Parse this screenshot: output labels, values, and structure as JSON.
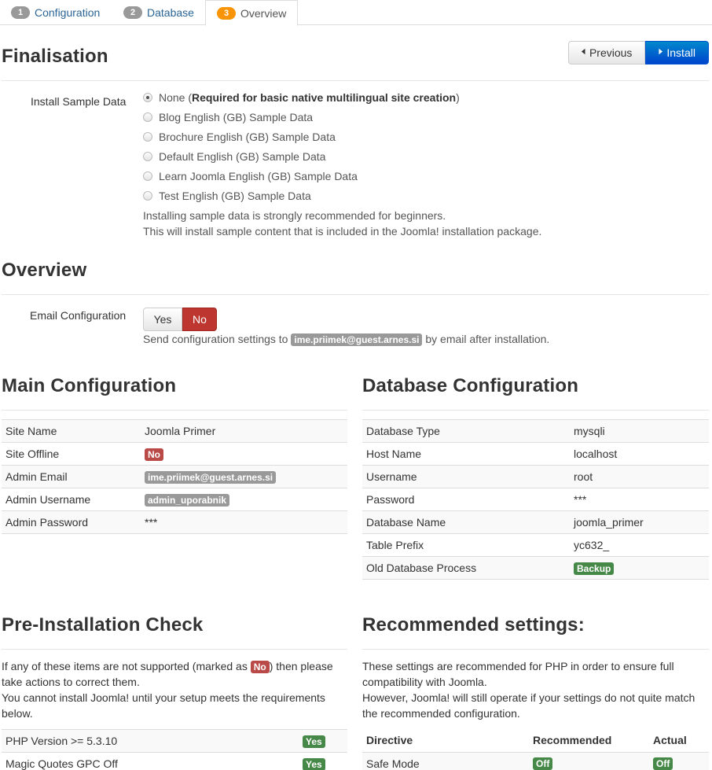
{
  "tabs": [
    {
      "num": "1",
      "label": "Configuration"
    },
    {
      "num": "2",
      "label": "Database"
    },
    {
      "num": "3",
      "label": "Overview"
    }
  ],
  "finalisation": {
    "title": "Finalisation",
    "previous_label": "Previous",
    "install_label": "Install",
    "sample_label": "Install Sample Data",
    "options": [
      {
        "label": "None (",
        "strong": "Required for basic native multilingual site creation",
        "tail": ")",
        "checked": true
      },
      {
        "label": "Blog English (GB) Sample Data",
        "checked": false
      },
      {
        "label": "Brochure English (GB) Sample Data",
        "checked": false
      },
      {
        "label": "Default English (GB) Sample Data",
        "checked": false
      },
      {
        "label": "Learn Joomla English (GB) Sample Data",
        "checked": false
      },
      {
        "label": "Test English (GB) Sample Data",
        "checked": false
      }
    ],
    "help1": "Installing sample data is strongly recommended for beginners.",
    "help2": "This will install sample content that is included in the Joomla! installation package."
  },
  "overview": {
    "title": "Overview",
    "email_label": "Email Configuration",
    "yes": "Yes",
    "no": "No",
    "send_prefix": "Send configuration settings to",
    "email": "ime.priimek@guest.arnes.si",
    "send_suffix": "by email after installation."
  },
  "main_config": {
    "title": "Main Configuration",
    "rows": [
      {
        "label": "Site Name",
        "value": "Joomla Primer"
      },
      {
        "label": "Site Offline",
        "value": "No"
      },
      {
        "label": "Admin Email",
        "value": "ime.priimek@guest.arnes.si"
      },
      {
        "label": "Admin Username",
        "value": "admin_uporabnik"
      },
      {
        "label": "Admin Password",
        "value": "***"
      }
    ]
  },
  "db_config": {
    "title": "Database Configuration",
    "rows": [
      {
        "label": "Database Type",
        "value": "mysqli"
      },
      {
        "label": "Host Name",
        "value": "localhost"
      },
      {
        "label": "Username",
        "value": "root"
      },
      {
        "label": "Password",
        "value": "***"
      },
      {
        "label": "Database Name",
        "value": "joomla_primer"
      },
      {
        "label": "Table Prefix",
        "value": "yc632_"
      },
      {
        "label": "Old Database Process",
        "value": "Backup"
      }
    ]
  },
  "preinstall": {
    "title": "Pre-Installation Check",
    "p1a": "If any of these items are not supported (marked as",
    "p1_badge": "No",
    "p1b": ") then please",
    "p2": "take actions to correct them.",
    "p3": "You cannot install Joomla! until your setup meets the requirements",
    "p4": "below.",
    "rows": [
      {
        "label": "PHP Version >= 5.3.10",
        "value": "Yes"
      },
      {
        "label": "Magic Quotes GPC Off",
        "value": "Yes"
      }
    ]
  },
  "recommended": {
    "title": "Recommended settings:",
    "p1": "These settings are recommended for PHP in order to ensure full",
    "p2": "compatibility with Joomla.",
    "p3": "However, Joomla! will still operate if your settings do not quite match",
    "p4": "the recommended configuration.",
    "headers": {
      "directive": "Directive",
      "recommended": "Recommended",
      "actual": "Actual"
    },
    "rows": [
      {
        "directive": "Safe Mode",
        "recommended": "Off",
        "actual": "Off"
      }
    ]
  },
  "colors": {
    "accent": "#0044cc",
    "danger": "#bd362f",
    "success": "#468847",
    "active_tab": "#f89406"
  }
}
